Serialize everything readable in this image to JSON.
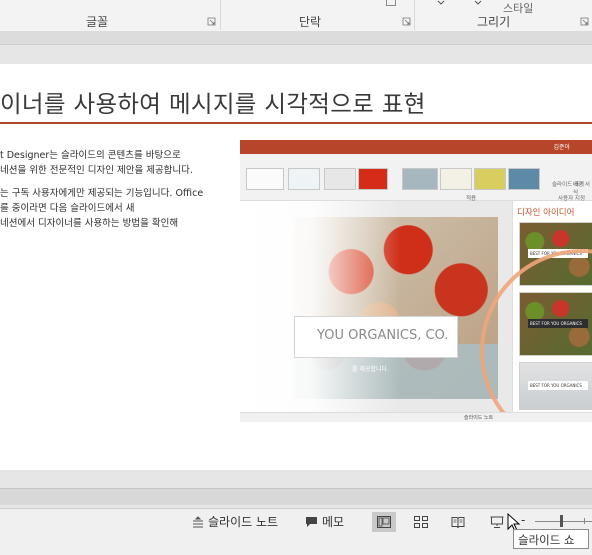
{
  "ribbon": {
    "groups": [
      {
        "label": "글꼴"
      },
      {
        "label": "단락"
      },
      {
        "label": "그리기"
      }
    ],
    "fragment": "스타일"
  },
  "slide": {
    "title": "이너를 사용하여 메시지를 시각적으로 표현",
    "body": [
      "t Designer는 슬라이드의 콘텐츠를 바탕으로",
      "네션을 위한 전문적인 디자인 제안을 제공합니다.",
      "는 구독 사용자에게만 제공되는 기능입니다. Office",
      "를 중이라면 다음 슬라이드에서 새",
      "네션에서 디자이너를 사용하는 방법을 확인해"
    ],
    "mock": {
      "user": "김준아",
      "ribbon_group_label": "적용",
      "designer_labels": [
        "슬라이드 크기",
        "배경 서식"
      ],
      "designer_group": "사용자 지정",
      "pane_title": "디자인 아이디어",
      "card_tag": "BEST FOR YOU ORGANICS",
      "banner_text": "YOU ORGANICS, CO.",
      "banner_sub": "를 제공합니다.",
      "status_notes": "슬라이드 노트"
    }
  },
  "statusbar": {
    "notes_label": "슬라이드 노트",
    "comments_label": "메모",
    "zoom_minus": "-"
  },
  "tooltip": {
    "text": "슬라이드 쇼"
  },
  "colors": {
    "accent": "#b0462b",
    "pane_accent": "#c5512d"
  }
}
